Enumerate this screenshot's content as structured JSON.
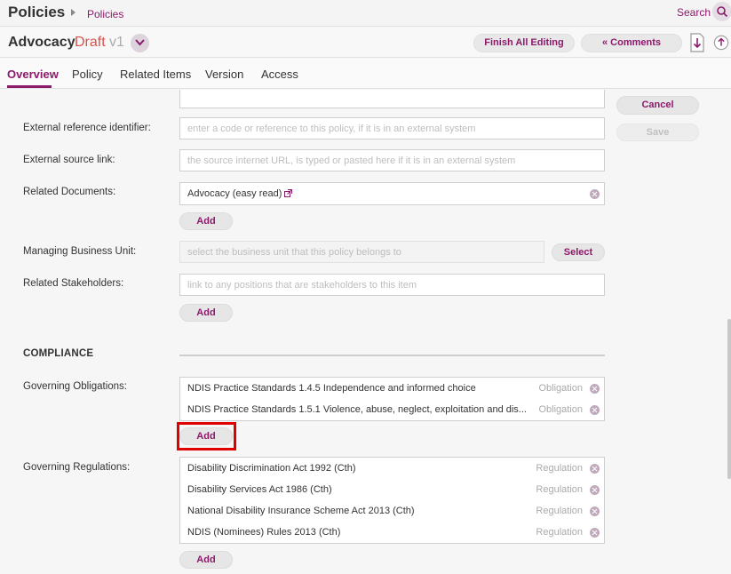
{
  "header": {
    "app_title": "Policies",
    "breadcrumb": "Policies",
    "search_label": "Search"
  },
  "document": {
    "title": "Advocacy",
    "state": "Draft",
    "version": "v1"
  },
  "toolbar": {
    "finish_label": "Finish All Editing",
    "comments_label": "«  Comments"
  },
  "tabs": [
    {
      "label": "Overview"
    },
    {
      "label": "Policy"
    },
    {
      "label": "Related Items"
    },
    {
      "label": "Version"
    },
    {
      "label": "Access"
    }
  ],
  "actions": {
    "cancel_label": "Cancel",
    "save_label": "Save"
  },
  "form": {
    "ext_ref": {
      "label": "External reference identifier:",
      "placeholder": "enter a code or reference to this policy, if it is in an external system"
    },
    "ext_link": {
      "label": "External source link:",
      "placeholder": "the source internet URL, is typed or pasted here if it is in an external system"
    },
    "related_docs": {
      "label": "Related Documents:",
      "value": "Advocacy (easy read)",
      "add_label": "Add"
    },
    "business_unit": {
      "label": "Managing Business Unit:",
      "placeholder": "select the business unit that this policy belongs to",
      "select_label": "Select"
    },
    "stakeholders": {
      "label": "Related Stakeholders:",
      "placeholder": "link to any positions that are stakeholders to this item",
      "add_label": "Add"
    }
  },
  "compliance": {
    "heading": "COMPLIANCE",
    "obligations": {
      "label": "Governing Obligations:",
      "add_label": "Add",
      "items": [
        {
          "text": "NDIS Practice Standards 1.4.5 Independence and informed choice",
          "type": "Obligation"
        },
        {
          "text": "NDIS Practice Standards 1.5.1 Violence, abuse, neglect, exploitation and dis...",
          "type": "Obligation"
        }
      ]
    },
    "regulations": {
      "label": "Governing Regulations:",
      "add_label": "Add",
      "items": [
        {
          "text": "Disability Discrimination Act 1992 (Cth)",
          "type": "Regulation"
        },
        {
          "text": "Disability Services Act 1986 (Cth)",
          "type": "Regulation"
        },
        {
          "text": "National Disability Insurance Scheme Act 2013 (Cth)",
          "type": "Regulation"
        },
        {
          "text": "NDIS (Nominees) Rules 2013 (Cth)",
          "type": "Regulation"
        }
      ]
    }
  },
  "colors": {
    "accent": "#8b1a6b",
    "draft": "#d9524b",
    "highlight": "#e00000"
  }
}
